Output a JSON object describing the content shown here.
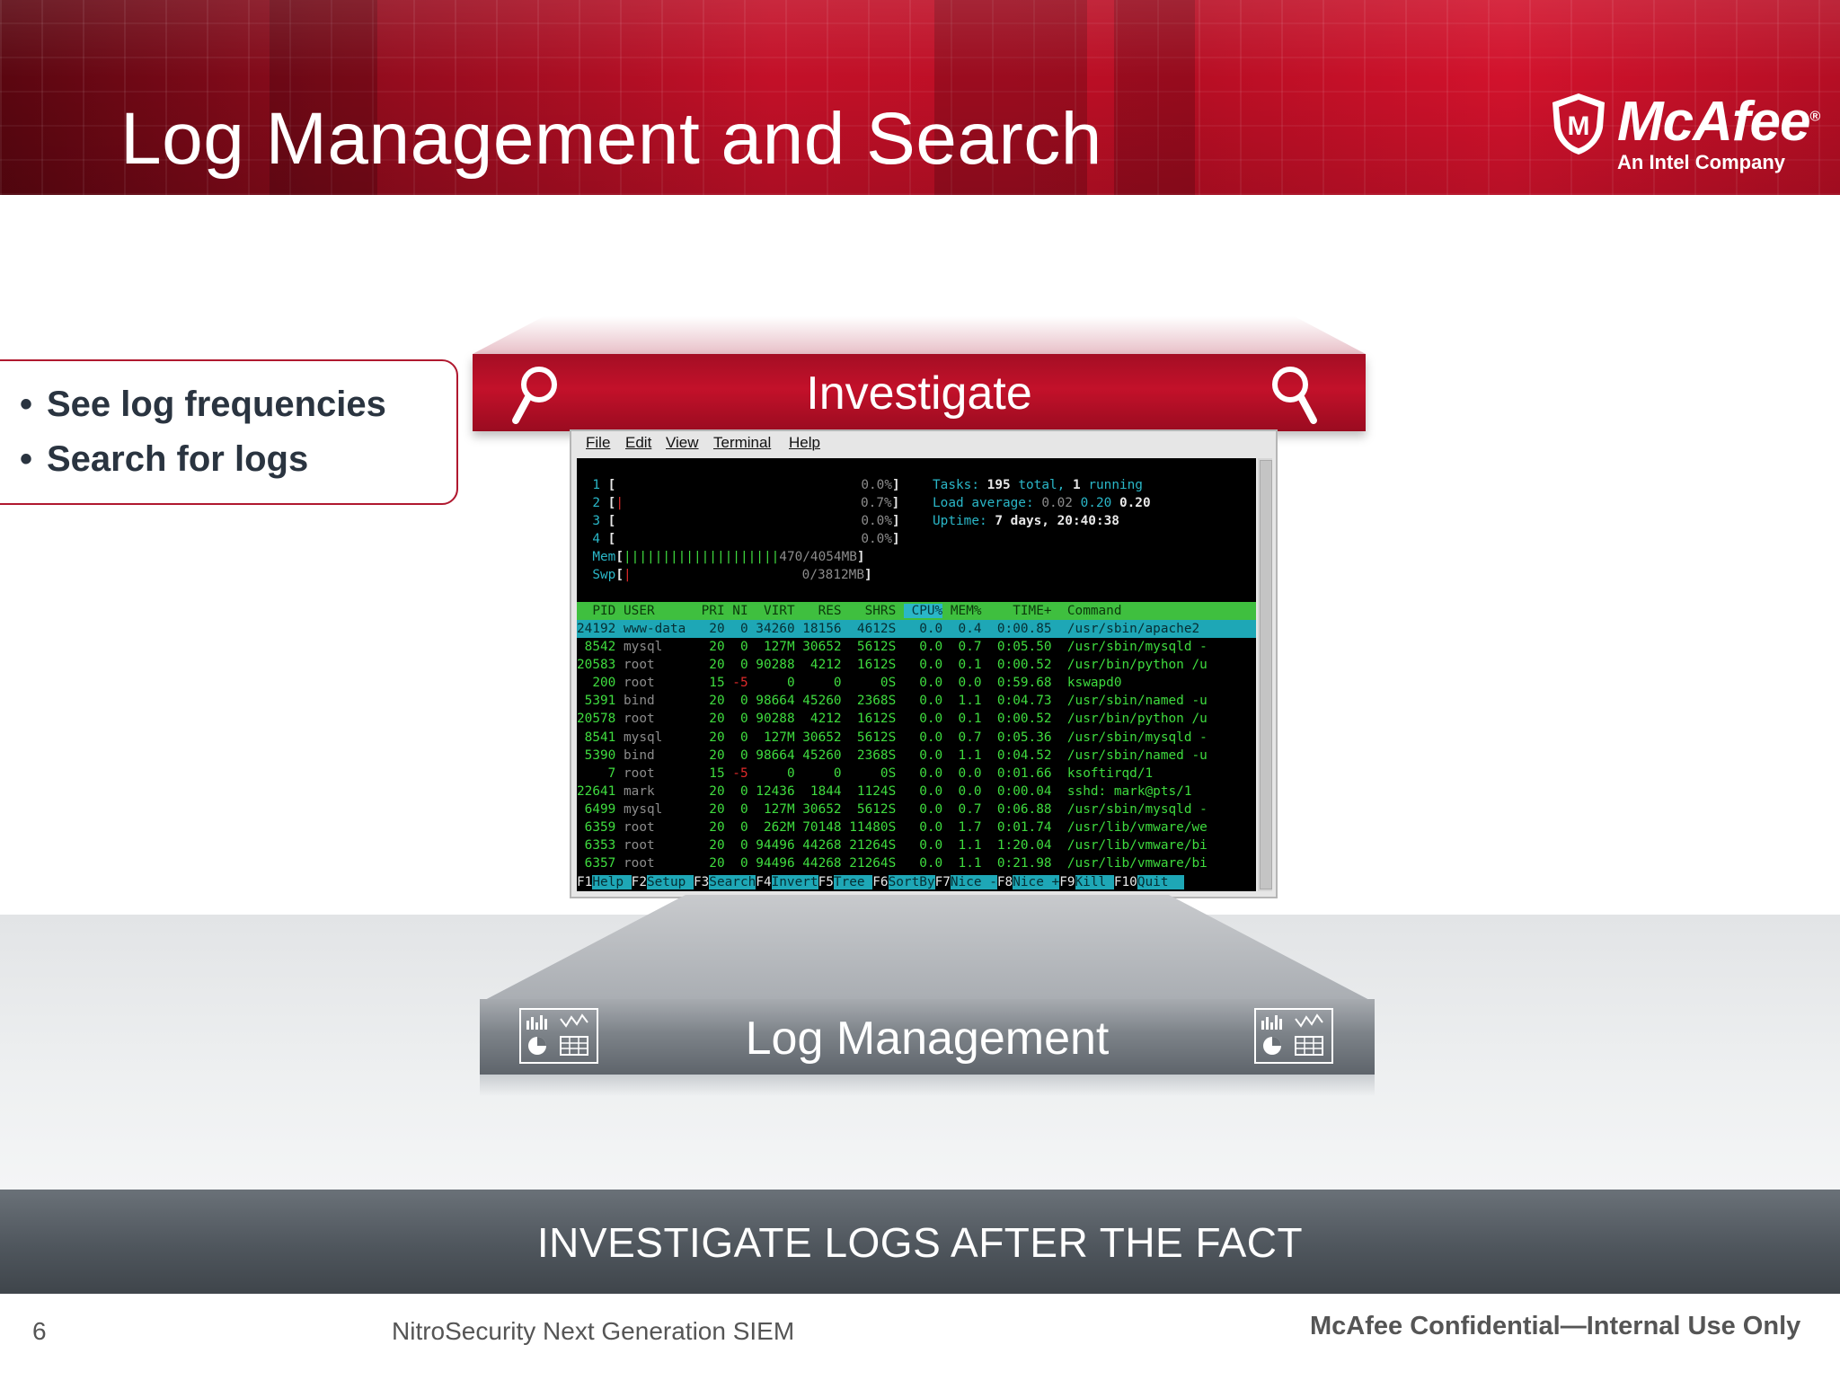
{
  "header": {
    "title": "Log Management and Search",
    "brand": "McAfee",
    "brand_mark": "®",
    "tagline": "An Intel Company",
    "logo_icon": "mcafee-shield-icon"
  },
  "callout": {
    "bullets": [
      "See log frequencies",
      "Search for logs"
    ]
  },
  "investigate": {
    "label": "Investigate",
    "icon": "magnifier-icon"
  },
  "terminal": {
    "menu": [
      "File",
      "Edit",
      "View",
      "Terminal",
      "Help"
    ],
    "cpu_meters": [
      {
        "num": "1",
        "bar": "",
        "pct": "0.0%"
      },
      {
        "num": "2",
        "bar": "|",
        "pct": "0.7%"
      },
      {
        "num": "3",
        "bar": "",
        "pct": "0.0%"
      },
      {
        "num": "4",
        "bar": "",
        "pct": "0.0%"
      }
    ],
    "mem": {
      "label": "Mem",
      "bar": "||||||||||||||||||||",
      "value": "470/4054MB"
    },
    "swp": {
      "label": "Swp",
      "bar": "|",
      "value": "0/3812MB"
    },
    "tasks": {
      "label": "Tasks:",
      "total": "195",
      "total_label": "total,",
      "running": "1",
      "running_label": "running"
    },
    "load": {
      "label": "Load average:",
      "v1": "0.02",
      "v2": "0.20",
      "v3": "0.20"
    },
    "uptime": {
      "label": "Uptime:",
      "value": "7 days, 20:40:38"
    },
    "columns": [
      "PID",
      "USER",
      "PRI",
      "NI",
      "VIRT",
      "RES",
      "SHR",
      "S",
      "CPU%",
      "MEM%",
      "TIME+",
      "Command"
    ],
    "processes": [
      [
        "24192",
        "www-data",
        "20",
        "0",
        "34260",
        "18156",
        "4612",
        "S",
        "0.0",
        "0.4",
        "0:00.85",
        "/usr/sbin/apache2"
      ],
      [
        "8542",
        "mysql",
        "20",
        "0",
        "127M",
        "30652",
        "5612",
        "S",
        "0.0",
        "0.7",
        "0:05.50",
        "/usr/sbin/mysqld -"
      ],
      [
        "20583",
        "root",
        "20",
        "0",
        "90288",
        "4212",
        "1612",
        "S",
        "0.0",
        "0.1",
        "0:00.52",
        "/usr/bin/python /u"
      ],
      [
        "200",
        "root",
        "15",
        "-5",
        "0",
        "0",
        "0",
        "S",
        "0.0",
        "0.0",
        "0:59.68",
        "kswapd0"
      ],
      [
        "5391",
        "bind",
        "20",
        "0",
        "98664",
        "45260",
        "2368",
        "S",
        "0.0",
        "1.1",
        "0:04.73",
        "/usr/sbin/named -u"
      ],
      [
        "20578",
        "root",
        "20",
        "0",
        "90288",
        "4212",
        "1612",
        "S",
        "0.0",
        "0.1",
        "0:00.52",
        "/usr/bin/python /u"
      ],
      [
        "8541",
        "mysql",
        "20",
        "0",
        "127M",
        "30652",
        "5612",
        "S",
        "0.0",
        "0.7",
        "0:05.36",
        "/usr/sbin/mysqld -"
      ],
      [
        "5390",
        "bind",
        "20",
        "0",
        "98664",
        "45260",
        "2368",
        "S",
        "0.0",
        "1.1",
        "0:04.52",
        "/usr/sbin/named -u"
      ],
      [
        "7",
        "root",
        "15",
        "-5",
        "0",
        "0",
        "0",
        "S",
        "0.0",
        "0.0",
        "0:01.66",
        "ksoftirqd/1"
      ],
      [
        "22641",
        "mark",
        "20",
        "0",
        "12436",
        "1844",
        "1124",
        "S",
        "0.0",
        "0.0",
        "0:00.04",
        "sshd: mark@pts/1"
      ],
      [
        "6499",
        "mysql",
        "20",
        "0",
        "127M",
        "30652",
        "5612",
        "S",
        "0.0",
        "0.7",
        "0:06.88",
        "/usr/sbin/mysqld -"
      ],
      [
        "6359",
        "root",
        "20",
        "0",
        "262M",
        "70148",
        "11480",
        "S",
        "0.0",
        "1.7",
        "0:01.74",
        "/usr/lib/vmware/we"
      ],
      [
        "6353",
        "root",
        "20",
        "0",
        "94496",
        "44268",
        "21264",
        "S",
        "0.0",
        "1.1",
        "1:20.04",
        "/usr/lib/vmware/bi"
      ],
      [
        "6357",
        "root",
        "20",
        "0",
        "94496",
        "44268",
        "21264",
        "S",
        "0.0",
        "1.1",
        "0:21.98",
        "/usr/lib/vmware/bi"
      ]
    ],
    "fkeys": [
      {
        "key": "F1",
        "label": "Help"
      },
      {
        "key": "F2",
        "label": "Setup"
      },
      {
        "key": "F3",
        "label": "Search"
      },
      {
        "key": "F4",
        "label": "Invert"
      },
      {
        "key": "F5",
        "label": "Tree"
      },
      {
        "key": "F6",
        "label": "SortBy"
      },
      {
        "key": "F7",
        "label": "Nice -"
      },
      {
        "key": "F8",
        "label": "Nice +"
      },
      {
        "key": "F9",
        "label": "Kill"
      },
      {
        "key": "F10",
        "label": "Quit"
      }
    ]
  },
  "log_management": {
    "label": "Log Management",
    "icon": "dashboard-icon"
  },
  "footer": {
    "band_text": "INVESTIGATE LOGS AFTER THE FACT",
    "page_number": "6",
    "center": "NitroSecurity Next Generation SIEM",
    "right": "McAfee Confidential—Internal Use Only"
  },
  "colors": {
    "accent_red": "#c3112a",
    "terminal_green": "#3fdc3f",
    "terminal_cyan": "#2ab7c8",
    "footer_gray": "#4f565d"
  }
}
